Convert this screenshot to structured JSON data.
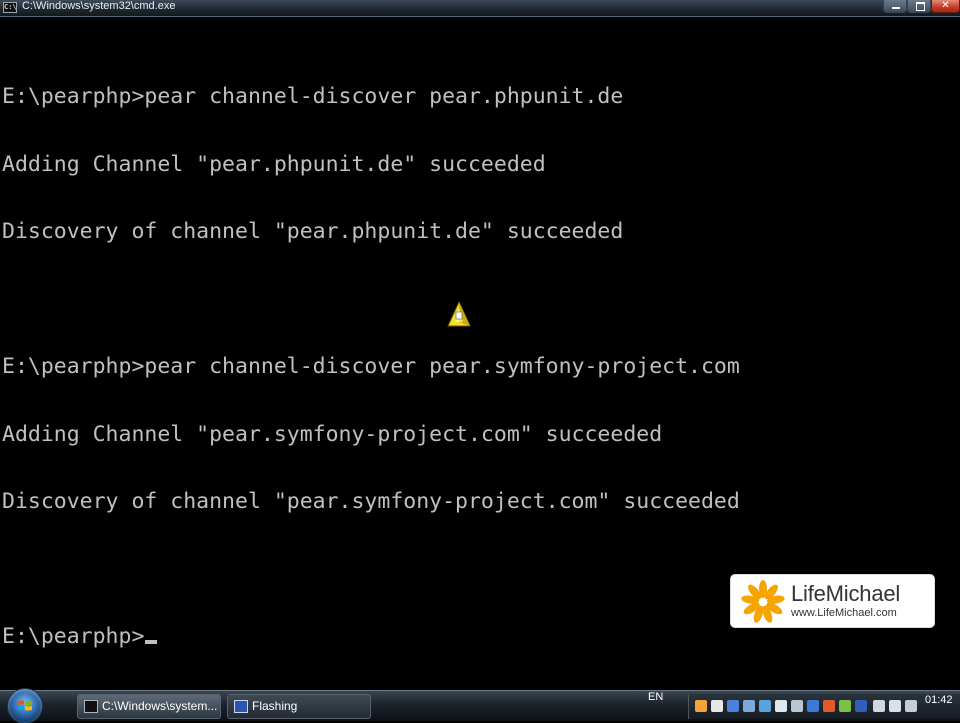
{
  "window": {
    "title": "C:\\Windows\\system32\\cmd.exe",
    "icon": "console-icon",
    "controls": [
      "minimize",
      "maximize",
      "close"
    ],
    "close_glyph": "✕"
  },
  "console": {
    "lines": [
      "E:\\pearphp>pear channel-discover pear.phpunit.de",
      "Adding Channel \"pear.phpunit.de\" succeeded",
      "Discovery of channel \"pear.phpunit.de\" succeeded",
      "",
      "E:\\pearphp>pear channel-discover pear.symfony-project.com",
      "Adding Channel \"pear.symfony-project.com\" succeeded",
      "Discovery of channel \"pear.symfony-project.com\" succeeded",
      "",
      "E:\\pearphp>"
    ],
    "text_color": "#c0c0c0",
    "background": "#000000"
  },
  "watermark": {
    "brand": "LifeMichael",
    "url": "www.LifeMichael.com",
    "accent": "#f5a500"
  },
  "taskbar": {
    "buttons": [
      {
        "label": "C:\\Windows\\system...",
        "icon": "console-icon",
        "active": true
      },
      {
        "label": "Flashing",
        "icon": "flash-icon",
        "active": false
      }
    ],
    "language": "EN",
    "clock": "01:42"
  }
}
